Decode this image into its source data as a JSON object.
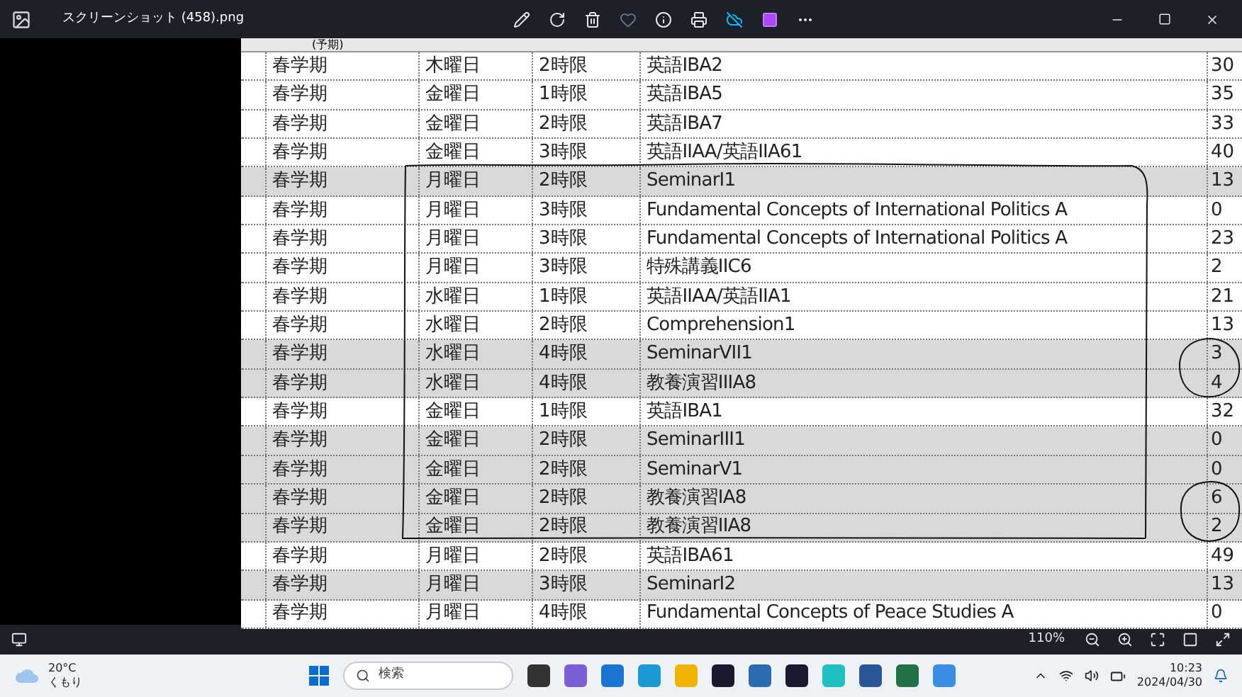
{
  "window": {
    "title": "スクリーンショット (458).png"
  },
  "table": {
    "header": "(予期)",
    "rows": [
      {
        "term": "春学期",
        "day": "木曜日",
        "period": "2時限",
        "course": "英語IBA2",
        "count": "30",
        "highlighted": false
      },
      {
        "term": "春学期",
        "day": "金曜日",
        "period": "1時限",
        "course": "英語IBA5",
        "count": "35",
        "highlighted": false
      },
      {
        "term": "春学期",
        "day": "金曜日",
        "period": "2時限",
        "course": "英語IBA7",
        "count": "33",
        "highlighted": false
      },
      {
        "term": "春学期",
        "day": "金曜日",
        "period": "3時限",
        "course": "英語IIAA/英語IIA61",
        "count": "40",
        "highlighted": false
      },
      {
        "term": "春学期",
        "day": "月曜日",
        "period": "2時限",
        "course": "SeminarI1",
        "count": "13",
        "highlighted": true
      },
      {
        "term": "春学期",
        "day": "月曜日",
        "period": "3時限",
        "course": "Fundamental Concepts of International Politics A",
        "count": "0",
        "highlighted": false
      },
      {
        "term": "春学期",
        "day": "月曜日",
        "period": "3時限",
        "course": "Fundamental Concepts of International Politics A",
        "count": "23",
        "highlighted": false
      },
      {
        "term": "春学期",
        "day": "月曜日",
        "period": "3時限",
        "course": "特殊講義IIC6",
        "count": "2",
        "highlighted": false
      },
      {
        "term": "春学期",
        "day": "水曜日",
        "period": "1時限",
        "course": "英語IIAA/英語IIA1",
        "count": "21",
        "highlighted": false
      },
      {
        "term": "春学期",
        "day": "水曜日",
        "period": "2時限",
        "course": "Comprehension1",
        "count": "13",
        "highlighted": false
      },
      {
        "term": "春学期",
        "day": "水曜日",
        "period": "4時限",
        "course": "SeminarVII1",
        "count": "3",
        "highlighted": true
      },
      {
        "term": "春学期",
        "day": "水曜日",
        "period": "4時限",
        "course": "教養演習IIIA8",
        "count": "4",
        "highlighted": true
      },
      {
        "term": "春学期",
        "day": "金曜日",
        "period": "1時限",
        "course": "英語IBA1",
        "count": "32",
        "highlighted": false
      },
      {
        "term": "春学期",
        "day": "金曜日",
        "period": "2時限",
        "course": "SeminarIII1",
        "count": "0",
        "highlighted": true
      },
      {
        "term": "春学期",
        "day": "金曜日",
        "period": "2時限",
        "course": "SeminarV1",
        "count": "0",
        "highlighted": true
      },
      {
        "term": "春学期",
        "day": "金曜日",
        "period": "2時限",
        "course": "教養演習IA8",
        "count": "6",
        "highlighted": true
      },
      {
        "term": "春学期",
        "day": "金曜日",
        "period": "2時限",
        "course": "教養演習IIA8",
        "count": "2",
        "highlighted": true
      },
      {
        "term": "春学期",
        "day": "月曜日",
        "period": "2時限",
        "course": "英語IBA61",
        "count": "49",
        "highlighted": false
      },
      {
        "term": "春学期",
        "day": "月曜日",
        "period": "3時限",
        "course": "SeminarI2",
        "count": "13",
        "highlighted": true
      },
      {
        "term": "春学期",
        "day": "月曜日",
        "period": "4時限",
        "course": "Fundamental Concepts of Peace Studies A",
        "count": "0",
        "highlighted": false
      }
    ]
  },
  "viewer_bar": {
    "zoom": "110%"
  },
  "taskbar": {
    "temperature": "20°C",
    "weather": "くもり",
    "search_placeholder": "検索",
    "time": "10:23",
    "date": "2024/04/30"
  }
}
